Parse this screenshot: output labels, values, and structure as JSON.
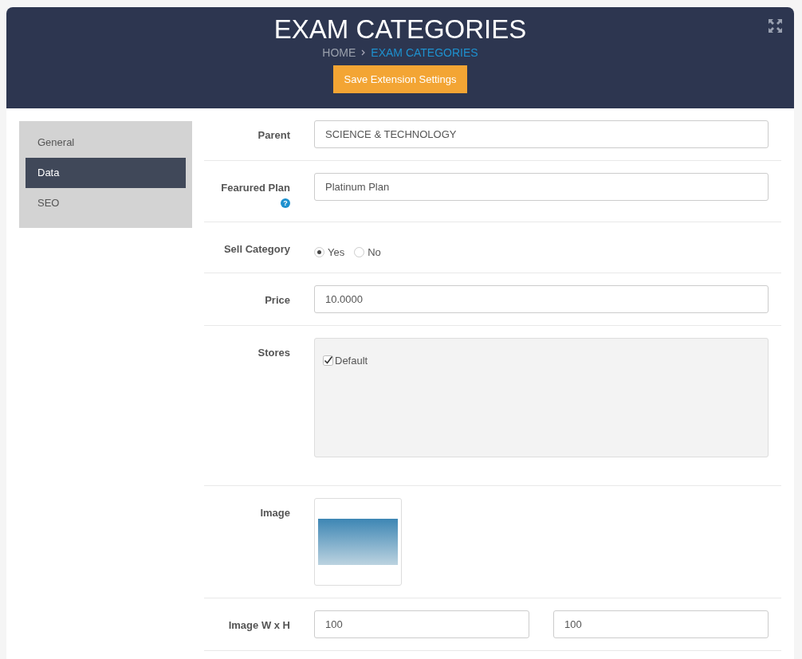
{
  "header": {
    "title": "EXAM CATEGORIES",
    "breadcrumb": [
      {
        "label": "HOME",
        "selected": false
      },
      {
        "label": "EXAM CATEGORIES",
        "selected": true
      }
    ],
    "save_button": "Save Extension Settings"
  },
  "sidebar": {
    "items": [
      {
        "label": "General",
        "selected": false
      },
      {
        "label": "Data",
        "selected": true
      },
      {
        "label": "SEO",
        "selected": false
      }
    ]
  },
  "form": {
    "rows": [
      {
        "kind": "text",
        "label": "Parent",
        "value": "SCIENCE & TECHNOLOGY"
      },
      {
        "kind": "text",
        "label": "Fearured Plan",
        "help": "?",
        "value": "Platinum Plan"
      },
      {
        "kind": "radio",
        "label": "Sell Category",
        "options": [
          {
            "label": "Yes",
            "selected": true
          },
          {
            "label": "No",
            "selected": false
          }
        ]
      },
      {
        "kind": "text",
        "label": "Price",
        "value": "10.0000"
      },
      {
        "kind": "checkboxes",
        "label": "Stores",
        "options": [
          {
            "label": "Default",
            "checked": true
          }
        ]
      },
      {
        "kind": "image",
        "label": "Image"
      },
      {
        "kind": "dimensions",
        "label": "Image W x H",
        "values": [
          "100",
          "100"
        ]
      }
    ]
  }
}
